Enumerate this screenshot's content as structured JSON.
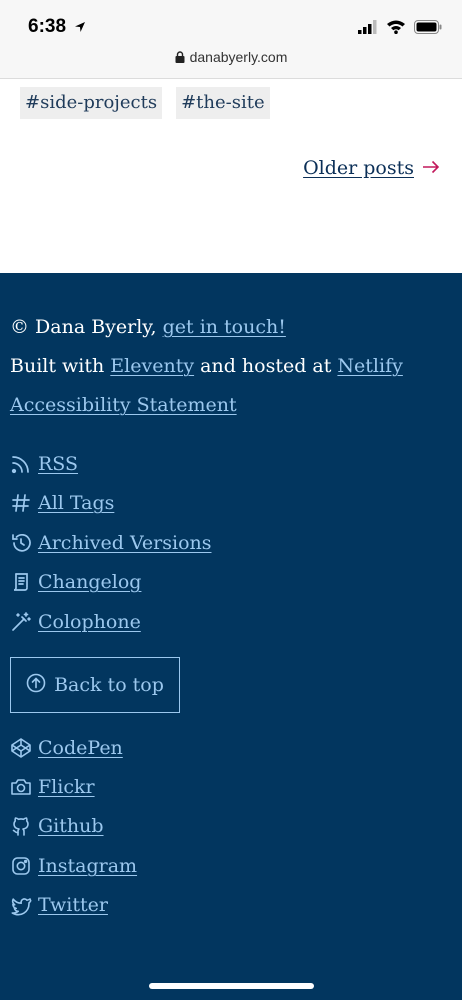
{
  "status_bar": {
    "time": "6:38",
    "url": "danabyerly.com"
  },
  "tags": [
    "#side-projects",
    "#the-site"
  ],
  "pagination": {
    "older_label": "Older posts",
    "arrow": "→"
  },
  "footer": {
    "copyright_prefix": "© Dana Byerly,",
    "contact_link": "get in touch!",
    "built_with_prefix": "Built with",
    "eleventy_link": "Eleventy",
    "hosted_text": "and hosted at",
    "netlify_link": "Netlify",
    "accessibility_link": "Accessibility Statement",
    "nav_links": [
      {
        "label": "RSS",
        "icon": "rss-icon"
      },
      {
        "label": "All Tags",
        "icon": "hash-icon"
      },
      {
        "label": "Archived Versions",
        "icon": "history-icon"
      },
      {
        "label": "Changelog",
        "icon": "scroll-icon"
      },
      {
        "label": "Colophone",
        "icon": "magic-wand-icon"
      }
    ],
    "back_to_top": "Back to top",
    "social_links": [
      {
        "label": "CodePen",
        "icon": "codepen-icon"
      },
      {
        "label": "Flickr",
        "icon": "camera-icon"
      },
      {
        "label": "Github",
        "icon": "github-icon"
      },
      {
        "label": "Instagram",
        "icon": "instagram-icon"
      },
      {
        "label": "Twitter",
        "icon": "twitter-icon"
      }
    ]
  },
  "colors": {
    "footer_bg": "#02365f",
    "link": "#9cc8ee",
    "accent_arrow": "#c2185b",
    "tag_bg": "#eeeeee"
  }
}
